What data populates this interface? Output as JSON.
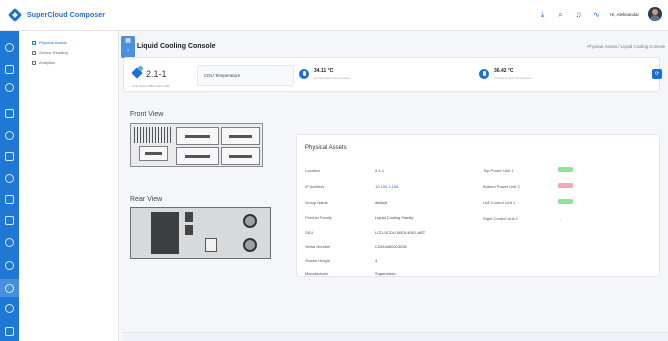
{
  "app": {
    "brand_name": "SuperCloud Composer"
  },
  "header": {
    "user_name": "Hi, Aleksandar"
  },
  "sidebar": {
    "items": [
      {
        "label": "Physical Assets"
      },
      {
        "label": "Sensor Reading"
      },
      {
        "label": "Analytics"
      }
    ]
  },
  "page": {
    "title": "Liquid Cooling Console",
    "breadcrumb": "Physical Assets / Liquid Cooling Console"
  },
  "summary": {
    "device_name": "2.1-1",
    "device_sub": "LCD-SCDU-0BOL4001-ABT",
    "metric_label": "CDU Temperature",
    "metric1": {
      "value": "34.11 °C",
      "caption": "Condensation Temperature"
    },
    "metric2": {
      "value": "36.42 °C",
      "caption": "Coolant Supply Temperature"
    }
  },
  "views": {
    "front_label": "Front View",
    "rear_label": "Rear View"
  },
  "assets": {
    "title": "Physical Assets",
    "left_rows": [
      {
        "label": "Location",
        "value": "2.1-1"
      },
      {
        "label": "IP Address",
        "value": "10.150.1.156"
      },
      {
        "label": "Group Name",
        "value": "default"
      },
      {
        "label": "Product Family",
        "value": "Liquid Cooling Family"
      },
      {
        "label": "SKU",
        "value": "LCD-SCDU-0BOL4001-ABT"
      },
      {
        "label": "Serial Number",
        "value": "C2544450023030"
      },
      {
        "label": "Shown Height",
        "value": "4"
      },
      {
        "label": "Manufacturer",
        "value": "Supermicro"
      }
    ],
    "right_rows": [
      {
        "label": "Top Power Unit 1",
        "status": "Good"
      },
      {
        "label": "Bottom Power Unit 2",
        "status": "Bad"
      },
      {
        "label": "Left Control Unit 1",
        "status": "Good"
      },
      {
        "label": "Right Control Unit 2",
        "status": "-"
      }
    ]
  },
  "colors": {
    "accent": "#1d6fd8",
    "rail": "#1f78d6",
    "good": "#8ee39a",
    "bad": "#f5a6b8"
  }
}
